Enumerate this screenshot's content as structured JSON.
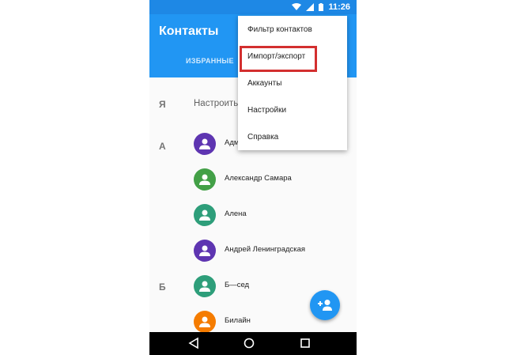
{
  "status_bar": {
    "time": "11:26",
    "icons": [
      "wifi-icon",
      "signal-icon",
      "battery-icon"
    ]
  },
  "app_bar": {
    "title": "Контакты",
    "tab_label": "ИЗБРАННЫЕ"
  },
  "list": {
    "sections": [
      {
        "letter": "Я",
        "text": "Настроить"
      },
      {
        "letter": "А"
      },
      {
        "letter": "Б"
      }
    ],
    "contacts": [
      {
        "name": "Адм",
        "color": "#5e35b1"
      },
      {
        "name": "Александр Самара",
        "color": "#43a047"
      },
      {
        "name": "Алена",
        "color": "#2e9e7a"
      },
      {
        "name": "Андрей Ленинградская",
        "color": "#5e35b1"
      },
      {
        "name": "Б—сед",
        "color": "#2e9e7a"
      },
      {
        "name": "Билайн",
        "color": "#f57c00"
      }
    ]
  },
  "menu": {
    "items": [
      {
        "label": "Фильтр контактов"
      },
      {
        "label": "Импорт/экспорт"
      },
      {
        "label": "Аккаунты"
      },
      {
        "label": "Настройки"
      },
      {
        "label": "Справка"
      }
    ],
    "highlight_color": "#d32f2f"
  },
  "colors": {
    "primary": "#2196f3",
    "status_bar": "#1e88e5"
  }
}
